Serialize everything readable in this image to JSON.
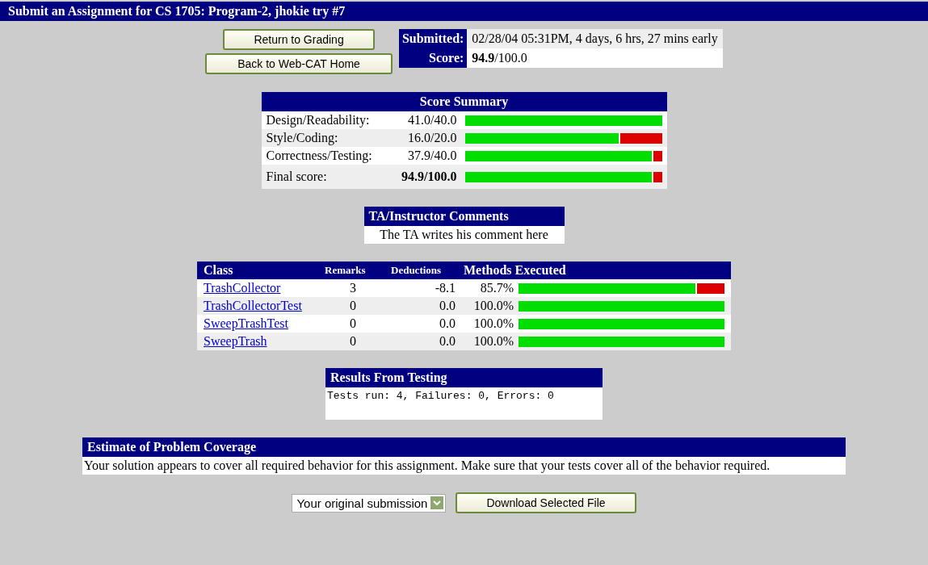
{
  "page_title": "Submit an Assignment for CS 1705: Program-2, jhokie try #7",
  "nav_buttons": [
    "Return to Grading",
    "Back to Web-CAT Home"
  ],
  "submission_info": [
    {
      "label": "Submitted:",
      "value": "02/28/04 05:31PM, 4 days, 6 hrs, 27 mins early"
    },
    {
      "label": "Score:",
      "value": "**94.9**/100.0"
    }
  ],
  "score_summary": {
    "title": "Score Summary",
    "rows": [
      {
        "label": "Design/Readability:",
        "score": "41.0/40.0",
        "level": 1.0
      },
      {
        "label": "Style/Coding:",
        "score": "16.0/20.0",
        "level": 0.78
      },
      {
        "label": "Correctness/Testing:",
        "score": "37.9/40.0",
        "level": 0.948
      }
    ],
    "final": {
      "label": "Final score:",
      "score": "94.9/100.0",
      "level": 0.949
    }
  },
  "comments": {
    "title": "TA/Instructor Comments",
    "text": "The TA writes his comment here"
  },
  "classes": {
    "columns": [
      "Class",
      "Remarks",
      "Deductions",
      "Methods Executed"
    ],
    "rows": [
      {
        "name": "TrashCollector",
        "remarks": "3",
        "deductions": "-8.1",
        "percent": "85.7%",
        "level": 0.857
      },
      {
        "name": "TrashCollectorTest",
        "remarks": "0",
        "deductions": "0.0",
        "percent": "100.0%",
        "level": 1.0
      },
      {
        "name": "SweepTrashTest",
        "remarks": "0",
        "deductions": "0.0",
        "percent": "100.0%",
        "level": 1.0
      },
      {
        "name": "SweepTrash",
        "remarks": "0",
        "deductions": "0.0",
        "percent": "100.0%",
        "level": 1.0
      }
    ]
  },
  "results": {
    "title": "Results From Testing",
    "text": "Tests run: 4, Failures: 0, Errors: 0"
  },
  "coverage": {
    "title": "Estimate of Problem Coverage",
    "text": "Your solution appears to cover all required behavior for this assignment. Make sure that your tests cover all of the behavior required."
  },
  "file_select": {
    "value": "Your original submission"
  },
  "download_button": "Download Selected File"
}
